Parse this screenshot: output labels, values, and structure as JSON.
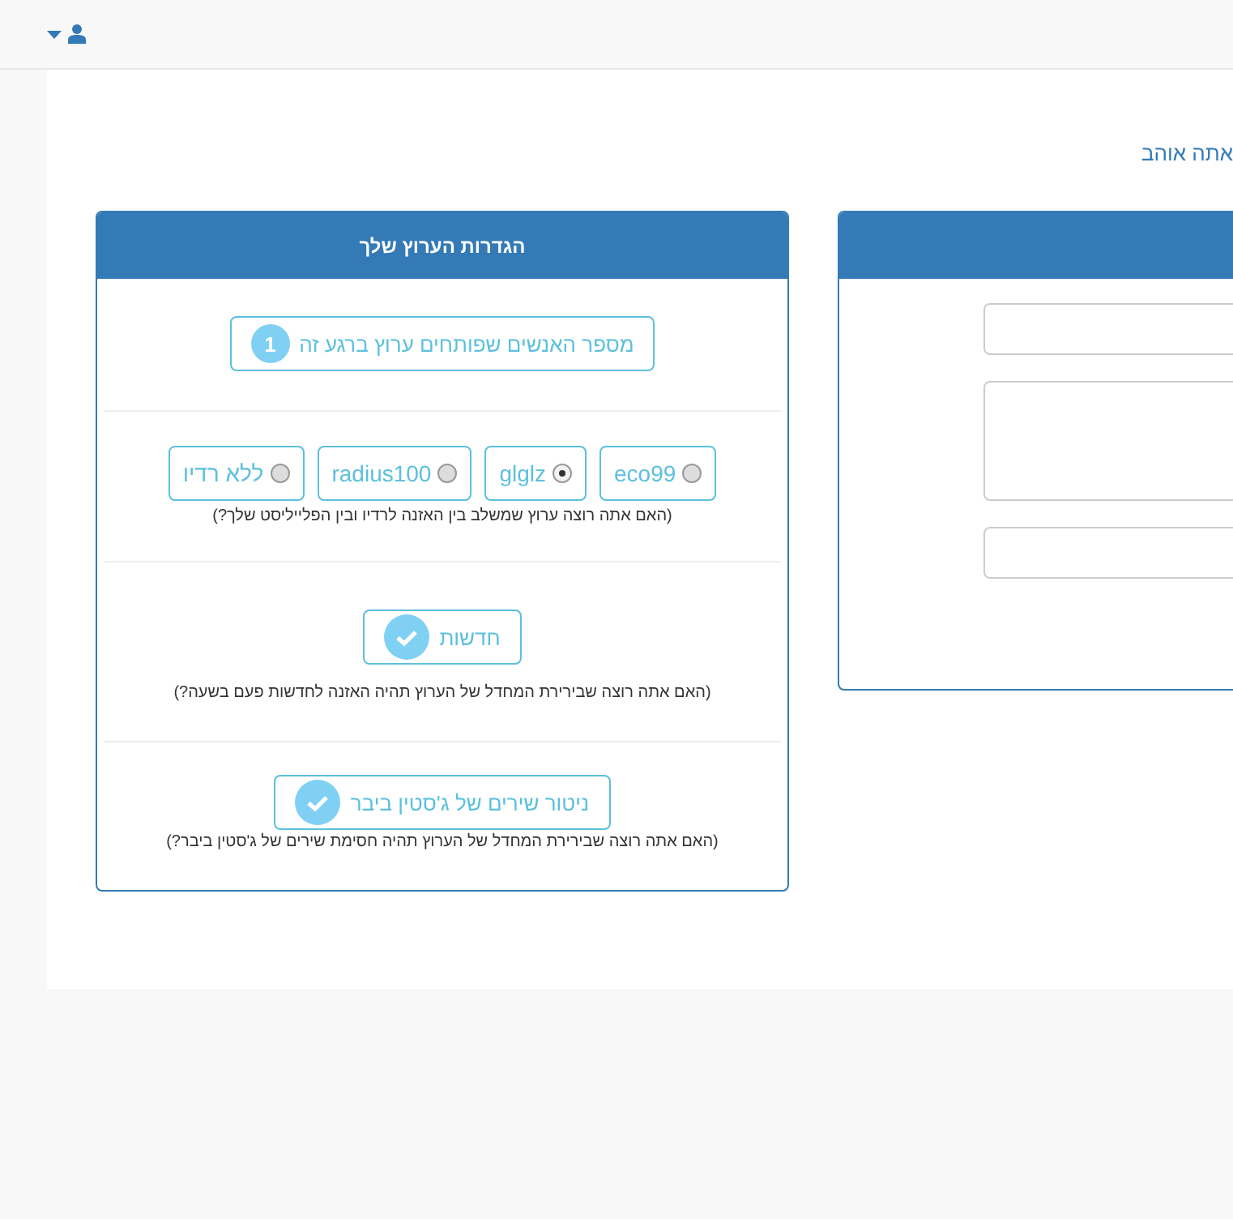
{
  "user_menu": {
    "expanded": false
  },
  "heading": "אתה אוהב",
  "settings_panel": {
    "title": "הגדרות הערוץ שלך",
    "listeners_button": {
      "label": "מספר האנשים שפותחים ערוץ ברגע זה",
      "count": "1"
    },
    "stations": [
      {
        "label": "eco99",
        "selected": false
      },
      {
        "label": "glglz",
        "selected": true
      },
      {
        "label": "radius100",
        "selected": false
      },
      {
        "label": "ללא רדיו",
        "selected": false
      }
    ],
    "stations_hint": "(האם אתה רוצה ערוץ שמשלב בין האזנה לרדיו ובין הפלייליסט שלך?)",
    "toggles": [
      {
        "label": "חדשות",
        "checked": true,
        "hint": "(האם אתה רוצה שבירירת המחדל של הערוץ תהיה האזנה לחדשות פעם בשעה?)"
      },
      {
        "label": "ניטור שירים של ג'סטין ביבר",
        "checked": true,
        "hint": "(האם אתה רוצה שבירירת המחדל של הערוץ תהיה חסימת שירים של ג'סטין ביבר?)"
      }
    ]
  },
  "form_panel": {
    "fields": [
      {
        "kind": "input"
      },
      {
        "kind": "textarea"
      },
      {
        "kind": "input"
      }
    ]
  }
}
